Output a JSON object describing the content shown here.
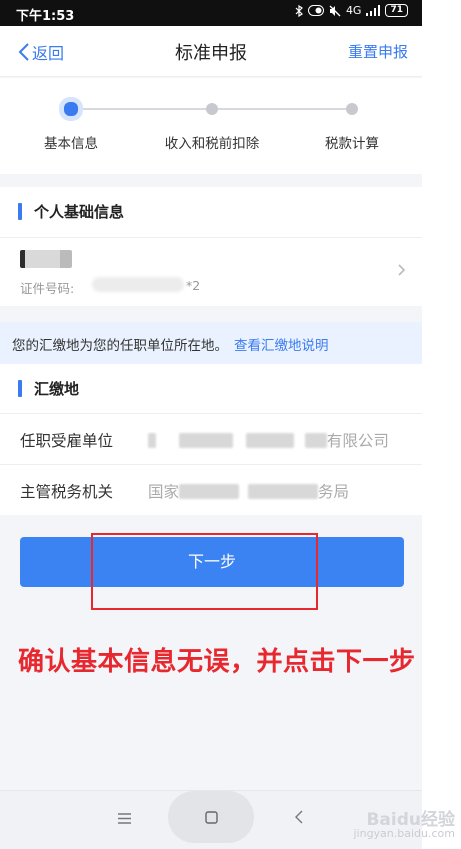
{
  "status_bar": {
    "time": "下午1:53",
    "network": "4G",
    "battery": "71"
  },
  "header": {
    "back_label": "返回",
    "title": "标准申报",
    "reset_label": "重置申报"
  },
  "steps": [
    {
      "label": "基本信息",
      "active": true
    },
    {
      "label": "收入和税前扣除",
      "active": false
    },
    {
      "label": "税款计算",
      "active": false
    }
  ],
  "personal_section": {
    "title": "个人基础信息",
    "id_label": "证件号码:",
    "id_tail": "*2"
  },
  "notice": {
    "text": "您的汇缴地为您的任职单位所在地。",
    "link": "查看汇缴地说明"
  },
  "remit_section": {
    "title": "汇缴地",
    "rows": [
      {
        "label": "任职受雇单位",
        "value_suffix": "有限公司"
      },
      {
        "label": "主管税务机关",
        "value_prefix": "国家",
        "value_suffix": "务局"
      }
    ]
  },
  "next_button": {
    "label": "下一步"
  },
  "annotation": "确认基本信息无误，并点击下一步",
  "watermark": {
    "brand": "Baidu经验",
    "url": "jingyan.baidu.com"
  },
  "colors": {
    "accent": "#3b7bf0",
    "annotation": "#e8282f",
    "notice_bg": "#e9f2fe"
  }
}
